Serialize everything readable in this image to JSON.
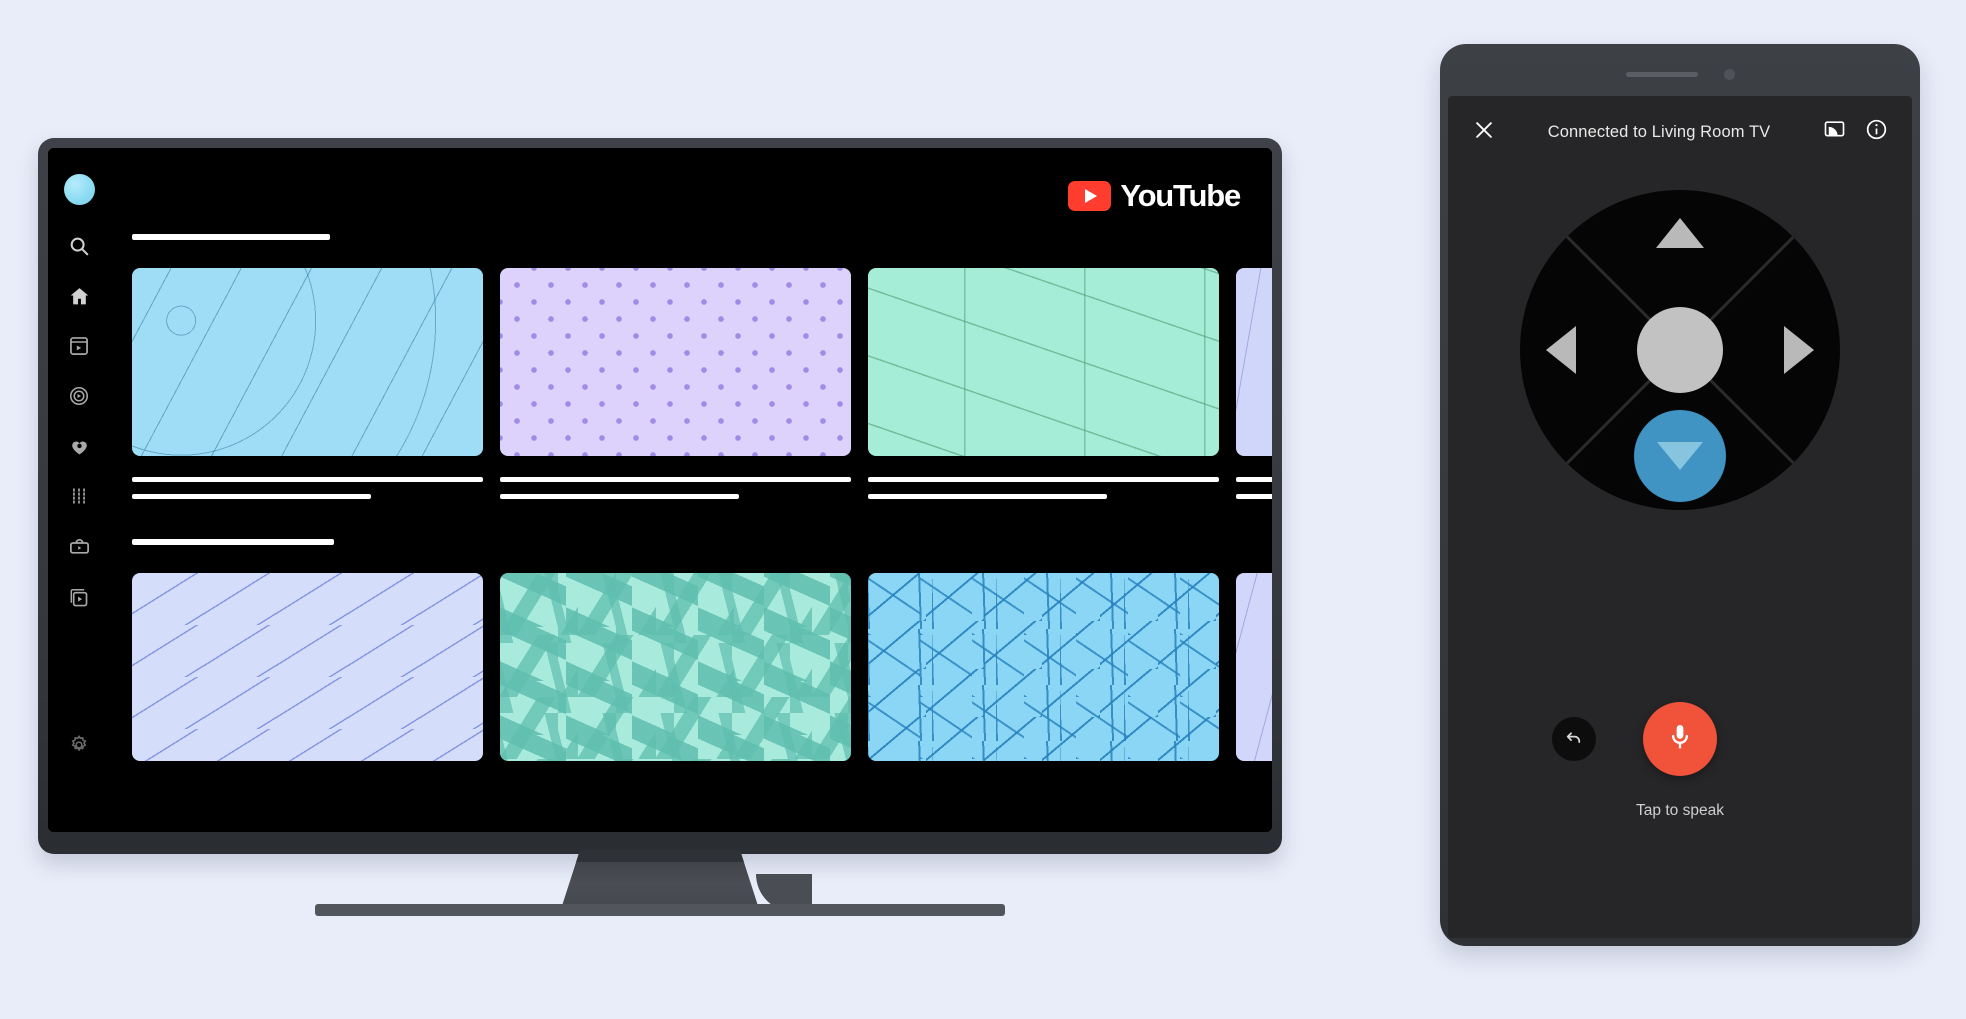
{
  "background_color": "#e8edf9",
  "tv": {
    "device_name": "living-room-tv",
    "app": "YouTube",
    "logo_text": "YouTube",
    "sidebar": {
      "avatar_label": "Account avatar",
      "items": [
        {
          "name": "search",
          "icon": "search-icon"
        },
        {
          "name": "home",
          "icon": "home-icon"
        },
        {
          "name": "shorts",
          "icon": "shorts-icon"
        },
        {
          "name": "explore",
          "icon": "explore-icon"
        },
        {
          "name": "subscriptions",
          "icon": "subscriptions-icon"
        },
        {
          "name": "library",
          "icon": "library-icon"
        },
        {
          "name": "your-videos",
          "icon": "your-videos-icon"
        },
        {
          "name": "watch-later",
          "icon": "watch-later-icon"
        }
      ],
      "bottom_item": {
        "name": "settings",
        "icon": "gear-icon"
      }
    },
    "shelves": [
      {
        "title_placeholder": true,
        "cards": [
          {
            "pattern": "squiggle-blue",
            "color": "#9fdcf5",
            "partial": false
          },
          {
            "pattern": "dots-lavender",
            "color": "#ddd2fb",
            "partial": false
          },
          {
            "pattern": "zigzag-mint",
            "color": "#a6edd8",
            "partial": false
          },
          {
            "pattern": "squiggle-peri",
            "color": "#cfd6fa",
            "partial": true
          }
        ]
      },
      {
        "title_placeholder": true,
        "cards": [
          {
            "pattern": "diag-peri",
            "color": "#d4defb",
            "partial": false
          },
          {
            "pattern": "confetti-aqua",
            "color": "#a8ebdd",
            "partial": false
          },
          {
            "pattern": "sticks-sky",
            "color": "#8bd6f5",
            "partial": false
          },
          {
            "pattern": "squig-lav",
            "color": "#d2d6fb",
            "partial": true
          }
        ]
      }
    ]
  },
  "phone": {
    "header": {
      "close_icon": "close-icon",
      "status_text": "Connected to Living Room TV",
      "cast_icon": "cast-connected-icon",
      "info_icon": "info-icon"
    },
    "dpad": {
      "up_label": "Up",
      "left_label": "Left",
      "right_label": "Right",
      "down_label": "Down",
      "ok_label": "Select",
      "active_direction": "down",
      "active_color": "#3f94c4",
      "arrow_color": "#b9b9b9",
      "ok_color": "#c2c2c2"
    },
    "controls": {
      "back_icon": "back-arrow-icon",
      "mic_icon": "microphone-icon",
      "mic_color": "#f0523a",
      "tap_to_speak_label": "Tap to speak"
    }
  }
}
